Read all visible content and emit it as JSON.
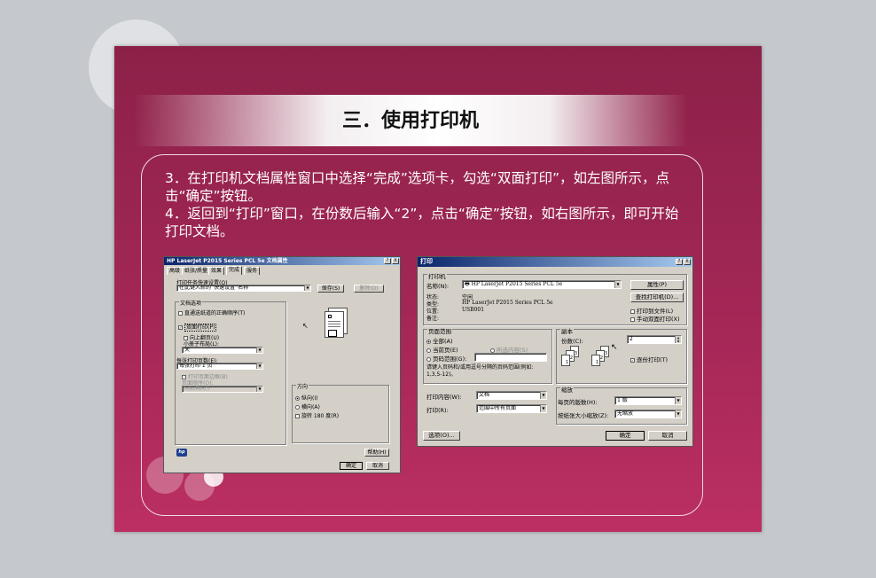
{
  "slide": {
    "title": "三．使用打印机",
    "para1": "3．在打印机文档属性窗口中选择“完成”选项卡，勾选“双面打印”，如左图所示，点击“确定”按钮。",
    "para2": "4．返回到“打印”窗口，在份数后输入“2”，点击“确定”按钮，如右图所示，即可开始打印文档。"
  },
  "left_dialog": {
    "title": "HP LaserJet P2015 Series PCL 5e 文档属性",
    "help_btn": "?",
    "close_btn": "X",
    "tabs": [
      "高级",
      "纸张/质量",
      "效果",
      "完成",
      "服务"
    ],
    "shortcuts_label": "打印任务快速设置(Q)",
    "shortcuts_value": "在此键入新的“快速设置”名称",
    "save_btn": "保存(S)",
    "delete_btn": "删除(D)",
    "doc_options_label": "文档选项",
    "straight_path": "直通送纸道的正确顺序(T)",
    "duplex": "双面打印(P)",
    "flip_up": "向上翻页(U)",
    "booklet_label": "小册子布局(L):",
    "booklet_value": "关",
    "pages_per_sheet_label": "每张打印页数(E):",
    "pages_per_sheet_value": "每张打印 1 页",
    "print_borders": "打印页面边框(B)",
    "page_order_label": "页面顺序(O):",
    "page_order_value": "向右再向下",
    "orientation_label": "方向",
    "portrait": "纵向(I)",
    "landscape": "横向(A)",
    "rotate": "旋转 180 度(R)",
    "help_button": "帮助(H)",
    "ok": "确定",
    "cancel": "取消",
    "logo": "hp"
  },
  "right_dialog": {
    "title": "打印",
    "help_btn": "?",
    "close_btn": "X",
    "printer_group": "打印机",
    "name_label": "名称(N):",
    "name_value": "HP LaserJet P2015 Series PCL 5e",
    "properties_btn": "属性(P)",
    "status_label": "状态:",
    "status_value": "空闲",
    "type_label": "类型:",
    "type_value": "HP LaserJet P2015 Series PCL 5e",
    "where_label": "位置:",
    "where_value": "USB001",
    "comment_label": "备注:",
    "find_printer_btn": "查找打印机(D)...",
    "print_to_file": "打印到文件(L)",
    "manual_duplex": "手动双面打印(X)",
    "page_range_group": "页面范围",
    "all": "全部(A)",
    "current_page": "当前页(E)",
    "selection": "所选内容(S)",
    "pages": "页码范围(G):",
    "range_hint": "请键入页码和/或用逗号分隔的页码范围(例如: 1,3,5-12)。",
    "copies_group": "副本",
    "copies_label": "份数(C):",
    "copies_value": "2",
    "collate": "逐份打印(T)",
    "print_what_label": "打印内容(W):",
    "print_what_value": "文档",
    "print_label": "打印(R):",
    "print_value": "范围中所有页面",
    "zoom_group": "缩放",
    "pages_per_sheet_label": "每页的版数(H):",
    "pages_per_sheet_value": "1 版",
    "scale_label": "按纸张大小缩放(Z):",
    "scale_value": "无缩放",
    "options_btn": "选项(O)...",
    "ok": "确定",
    "cancel": "取消",
    "page_nums": [
      "1",
      "2",
      "3",
      "1",
      "2",
      "3"
    ]
  },
  "colors": {
    "slide_top": "#8c2148",
    "slide_bottom": "#bc2f62",
    "dialog_face": "#d4d0c8",
    "title_bar": "#0a246a"
  }
}
